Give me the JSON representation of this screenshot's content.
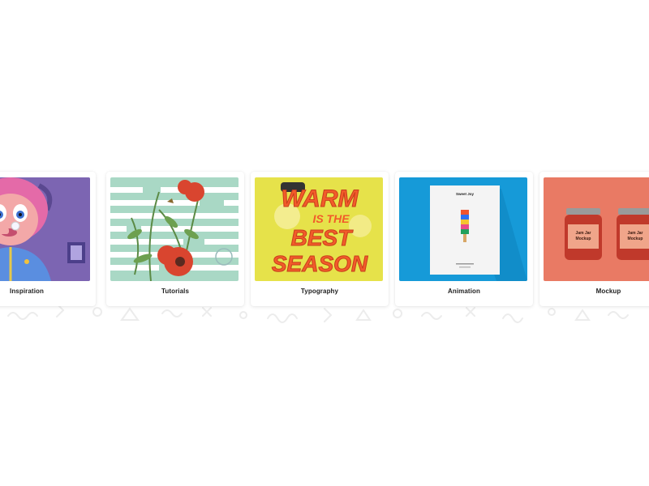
{
  "categories": [
    {
      "label": "Inspiration",
      "icon": "illustrated-girl-thumbnail"
    },
    {
      "label": "Tutorials",
      "icon": "floral-collage-thumbnail"
    },
    {
      "label": "Typography",
      "icon": "lettering-thumbnail"
    },
    {
      "label": "Animation",
      "icon": "poster-mockup-thumbnail"
    },
    {
      "label": "Mockup",
      "icon": "jar-mockup-thumbnail"
    }
  ],
  "thumbnail_text": {
    "typography": [
      "WARM",
      "IS THE",
      "BEST",
      "SEASON"
    ],
    "poster_heading": "Sweet Joy",
    "jar_label": [
      "Jam Jar",
      "Mockup"
    ]
  },
  "colors": {
    "background": "#ffffff",
    "card": "#ffffff",
    "label": "#222222",
    "inspiration_bg": "#6f5aa5",
    "tutorials_bg": "#a9d8c5",
    "typography_bg": "#e6e24a",
    "animation_bg": "#169ad8",
    "mockup_bg": "#e97a64"
  }
}
